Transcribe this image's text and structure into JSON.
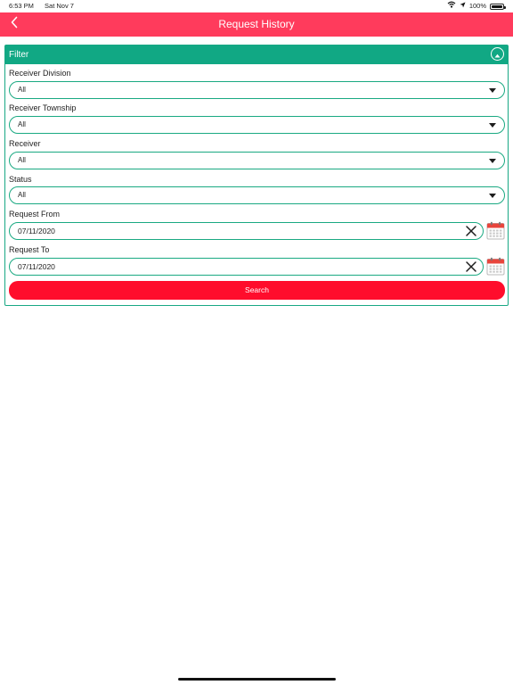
{
  "status_bar": {
    "time": "6:53 PM",
    "date": "Sat Nov 7",
    "battery_percent": "100%",
    "icons": [
      "wifi-icon",
      "location-icon",
      "battery-icon"
    ]
  },
  "nav": {
    "title": "Request History",
    "back_icon": "chevron-left-icon"
  },
  "filter": {
    "title": "Filter",
    "collapse_icon": "chevron-up-circle-icon",
    "fields": {
      "receiver_division": {
        "label": "Receiver Division",
        "value": "All"
      },
      "receiver_township": {
        "label": "Receiver Township",
        "value": "All"
      },
      "receiver": {
        "label": "Receiver",
        "value": "All"
      },
      "status": {
        "label": "Status",
        "value": "All"
      },
      "request_from": {
        "label": "Request From",
        "value": "07/11/2020"
      },
      "request_to": {
        "label": "Request To",
        "value": "07/11/2020"
      }
    },
    "search_label": "Search"
  },
  "colors": {
    "nav_bar": "#ff3b5c",
    "filter_header": "#11a884",
    "border": "#1aa982",
    "search_button": "#ff0d2c",
    "calendar_red": "#e8453c"
  }
}
